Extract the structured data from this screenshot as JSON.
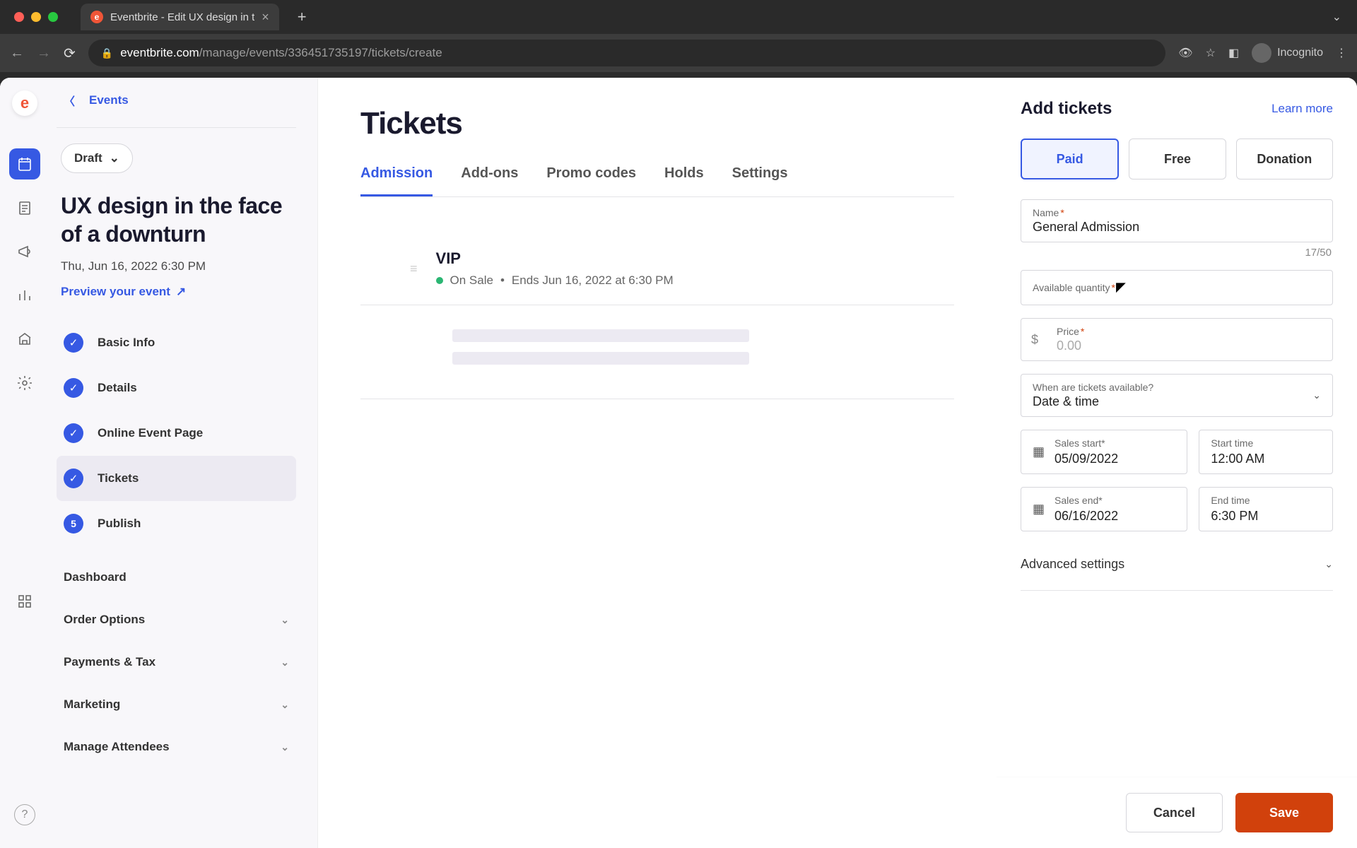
{
  "browser": {
    "tab_title": "Eventbrite - Edit UX design in t",
    "url_domain": "eventbrite.com",
    "url_path": "/manage/events/336451735197/tickets/create",
    "incognito_label": "Incognito"
  },
  "sidebar": {
    "back_label": "Events",
    "status": "Draft",
    "event_title": "UX design in the face of a downturn",
    "event_date": "Thu, Jun 16, 2022 6:30 PM",
    "preview_label": "Preview your event",
    "steps": [
      {
        "label": "Basic Info",
        "done": true
      },
      {
        "label": "Details",
        "done": true
      },
      {
        "label": "Online Event Page",
        "done": true
      },
      {
        "label": "Tickets",
        "done": true,
        "active": true
      },
      {
        "label": "Publish",
        "number": "5"
      }
    ],
    "groups": [
      "Dashboard",
      "Order Options",
      "Payments & Tax",
      "Marketing",
      "Manage Attendees"
    ]
  },
  "main": {
    "title": "Tickets",
    "tabs": [
      "Admission",
      "Add-ons",
      "Promo codes",
      "Holds",
      "Settings"
    ],
    "active_tab": "Admission",
    "existing_ticket": {
      "name": "VIP",
      "status": "On Sale",
      "ends": "Ends Jun 16, 2022 at 6:30 PM"
    }
  },
  "panel": {
    "title": "Add tickets",
    "learn_more": "Learn more",
    "types": [
      "Paid",
      "Free",
      "Donation"
    ],
    "selected_type": "Paid",
    "name_label": "Name",
    "name_value": "General Admission",
    "char_count": "17/50",
    "qty_label": "Available quantity",
    "price_label": "Price",
    "price_placeholder": "0.00",
    "currency_symbol": "$",
    "availability_label": "When are tickets available?",
    "availability_value": "Date & time",
    "sales_start_label": "Sales start",
    "sales_start_value": "05/09/2022",
    "start_time_label": "Start time",
    "start_time_value": "12:00 AM",
    "sales_end_label": "Sales end",
    "sales_end_value": "06/16/2022",
    "end_time_label": "End time",
    "end_time_value": "6:30 PM",
    "advanced_label": "Advanced settings",
    "cancel_label": "Cancel",
    "save_label": "Save"
  }
}
